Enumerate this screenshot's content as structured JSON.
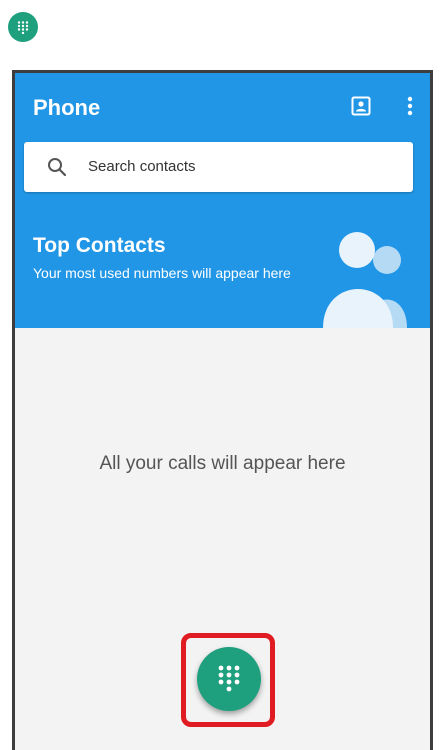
{
  "app": {
    "title": "Phone"
  },
  "search": {
    "placeholder": "Search contacts"
  },
  "top_contacts": {
    "title": "Top Contacts",
    "subtitle": "Your most used numbers will appear here"
  },
  "calls": {
    "empty_message": "All your calls will appear here"
  },
  "icons": {
    "app_icon": "dialpad-icon",
    "contacts": "contacts-icon",
    "more": "more-vert-icon",
    "search": "search-icon",
    "fab": "dialpad-icon"
  },
  "colors": {
    "primary": "#2196e6",
    "accent": "#1e9f7e",
    "highlight": "#e11b22",
    "background": "#f3f3f3"
  }
}
